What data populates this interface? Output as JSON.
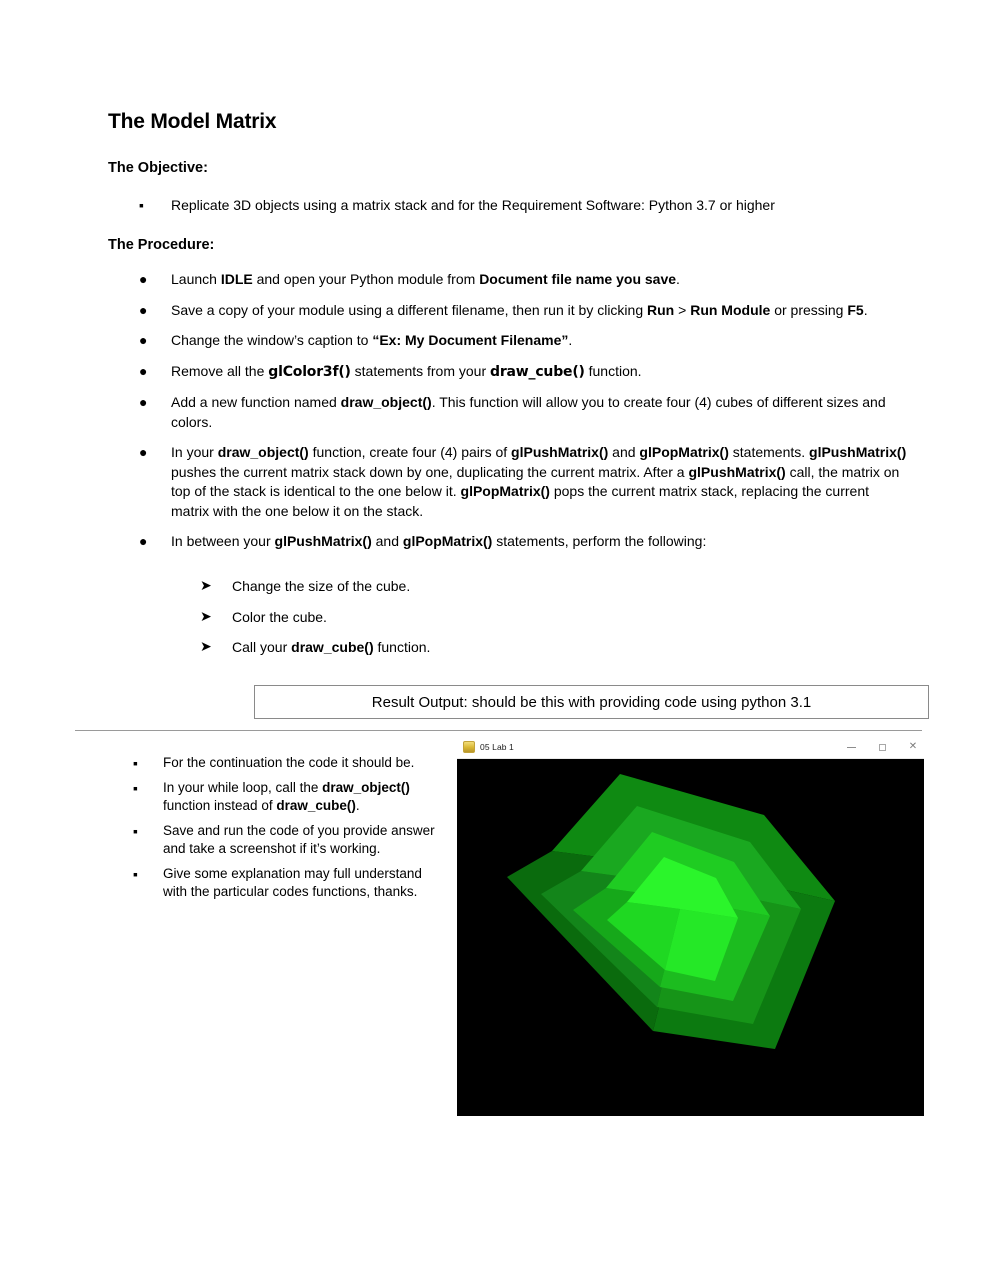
{
  "document": {
    "title": "The Model Matrix",
    "objective_heading": "The Objective:",
    "procedure_heading": "The Procedure:"
  },
  "objective": {
    "bullet_marker": "▪",
    "items": [
      "Replicate 3D objects using a matrix stack and for the Requirement Software: Python 3.7 or higher"
    ]
  },
  "procedure": {
    "bullet_marker": "●",
    "items": [
      {
        "parts": [
          {
            "text": "Launch ",
            "bold": false
          },
          {
            "text": "IDLE",
            "bold": true
          },
          {
            "text": " and open your Python module from ",
            "bold": false
          },
          {
            "text": "Document file name you save",
            "bold": true
          },
          {
            "text": ".",
            "bold": false
          }
        ]
      },
      {
        "parts": [
          {
            "text": "Save a copy of your module using a different filename, then run it by clicking ",
            "bold": false
          },
          {
            "text": "Run",
            "bold": true
          },
          {
            "text": " > ",
            "bold": false
          },
          {
            "text": "Run Module",
            "bold": true
          },
          {
            "text": " or pressing ",
            "bold": false
          },
          {
            "text": "F5",
            "bold": true
          },
          {
            "text": ".",
            "bold": false
          }
        ]
      },
      {
        "parts": [
          {
            "text": "Change the window’s caption to ",
            "bold": false
          },
          {
            "text": "“Ex: My Document Filename”",
            "bold": true
          },
          {
            "text": ".",
            "bold": false
          }
        ]
      },
      {
        "parts": [
          {
            "text": "Remove all the ",
            "bold": false
          },
          {
            "text": "glColor3f()",
            "bold": true,
            "mono": true
          },
          {
            "text": " statements from  your ",
            "bold": false
          },
          {
            "text": "draw_cube()",
            "bold": true,
            "mono": true
          },
          {
            "text": " function.",
            "bold": false
          }
        ]
      },
      {
        "parts": [
          {
            "text": "Add a new function named ",
            "bold": false
          },
          {
            "text": "draw_object()",
            "bold": true
          },
          {
            "text": ". This function will allow you to create four (4) cubes of different sizes and colors.",
            "bold": false
          }
        ]
      },
      {
        "parts": [
          {
            "text": "In your ",
            "bold": false
          },
          {
            "text": "draw_object()",
            "bold": true
          },
          {
            "text": " function, create four (4) pairs of ",
            "bold": false
          },
          {
            "text": "glPushMatrix()",
            "bold": true
          },
          {
            "text": " and ",
            "bold": false
          },
          {
            "text": "glPopMatrix()",
            "bold": true
          },
          {
            "text": " statements. ",
            "bold": false
          },
          {
            "text": "glPushMatrix()",
            "bold": true
          },
          {
            "text": " pushes the current matrix stack down by one, duplicating the current matrix. After a ",
            "bold": false
          },
          {
            "text": "glPushMatrix()",
            "bold": true
          },
          {
            "text": " call, the matrix on top of the stack is identical to the one below it. ",
            "bold": false
          },
          {
            "text": "glPopMatrix()",
            "bold": true
          },
          {
            "text": " pops the current matrix stack, replacing the current matrix with the one below it on the stack.",
            "bold": false
          }
        ]
      },
      {
        "parts": [
          {
            "text": "In between your ",
            "bold": false
          },
          {
            "text": "glPushMatrix()",
            "bold": true
          },
          {
            "text": " and ",
            "bold": false
          },
          {
            "text": "glPopMatrix()",
            "bold": true
          },
          {
            "text": " statements, perform the following:",
            "bold": false
          }
        ]
      }
    ]
  },
  "sub_procedure": {
    "bullet_marker": "➤",
    "items": [
      {
        "parts": [
          {
            "text": "Change the size of the cube.",
            "bold": false
          }
        ]
      },
      {
        "parts": [
          {
            "text": "Color the cube.",
            "bold": false
          }
        ]
      },
      {
        "parts": [
          {
            "text": "Call your ",
            "bold": false
          },
          {
            "text": "draw_cube()",
            "bold": true
          },
          {
            "text": " function.",
            "bold": false
          }
        ]
      }
    ]
  },
  "result_box": {
    "label": "Result Output: should be this with providing code using python 3.1"
  },
  "bottom_notes": {
    "bullet_marker": "▪",
    "items": [
      {
        "parts": [
          {
            "text": "For the continuation the code it should be.",
            "bold": false
          }
        ]
      },
      {
        "parts": [
          {
            "text": "In your while loop, call the ",
            "bold": false
          },
          {
            "text": "draw_object()",
            "bold": true
          },
          {
            "text": " function instead of ",
            "bold": false
          },
          {
            "text": "draw_cube()",
            "bold": true
          },
          {
            "text": ".",
            "bold": false
          }
        ]
      },
      {
        "parts": [
          {
            "text": "Save and run the code of you provide answer and take a screenshot if it’s working.",
            "bold": false
          }
        ]
      },
      {
        "parts": [
          {
            "text": "Give some explanation may full understand with the particular codes functions, thanks.",
            "bold": false
          }
        ]
      }
    ]
  },
  "app_window": {
    "title": "05 Lab 1",
    "icon": "python-app-icon",
    "controls": {
      "minimize": "–",
      "maximize": "□",
      "close": "✕"
    },
    "canvas": {
      "background": "#000000",
      "description": "Four nested rotated cubes rendered with OpenGL, from dark to bright green",
      "cube_colors": [
        "#0f8a12",
        "#1aa820",
        "#14c21c",
        "#22ee22"
      ],
      "cube_face_shades": {
        "cube1": {
          "top": "#0f8a12",
          "left": "#0a6b0d",
          "right": "#0c7a10"
        },
        "cube2": {
          "top": "#1aa820",
          "left": "#13851a",
          "right": "#169418"
        },
        "cube3": {
          "top": "#1fcc22",
          "left": "#16a81a",
          "right": "#1cbc1f"
        },
        "cube4": {
          "top": "#2bf52b",
          "left": "#1fd822",
          "right": "#25e827"
        }
      }
    }
  }
}
